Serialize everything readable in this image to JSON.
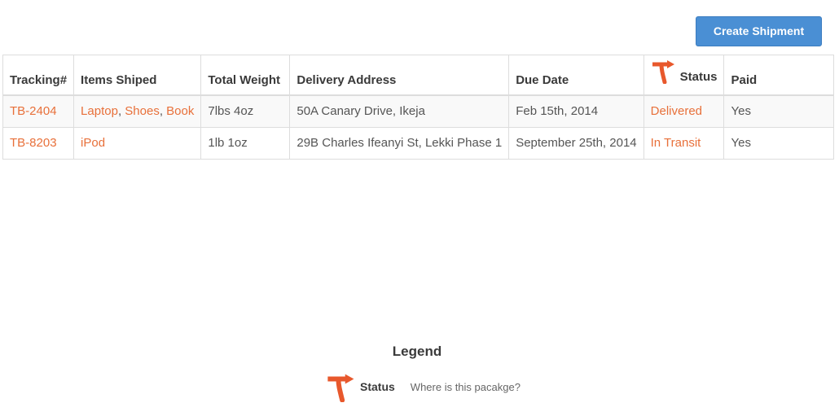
{
  "toolbar": {
    "create_label": "Create Shipment"
  },
  "table": {
    "headers": [
      "Tracking#",
      "Items Shiped",
      "Total Weight",
      "Delivery Address",
      "Due Date",
      "Status",
      "Paid"
    ],
    "rows": [
      {
        "tracking": "TB-2404",
        "items": [
          "Laptop",
          "Shoes",
          "Book"
        ],
        "weight": "7lbs 4oz",
        "address": "50A Canary Drive, Ikeja",
        "due": "Feb 15th, 2014",
        "status": "Delivered",
        "paid": "Yes"
      },
      {
        "tracking": "TB-8203",
        "items": [
          "iPod"
        ],
        "weight": "1lb 1oz",
        "address": "29B Charles Ifeanyi St, Lekki Phase 1",
        "due": "September 25th, 2014",
        "status": "In Transit",
        "paid": "Yes"
      }
    ],
    "item_separator": ","
  },
  "legend": {
    "title": "Legend",
    "status_label": "Status",
    "status_desc": "Where is this pacakge?"
  },
  "colors": {
    "accent": "#e8703a",
    "button": "#4a8fd4",
    "icon": "#e8582c"
  },
  "icons": {
    "status": "turn-right-arrow-icon"
  }
}
